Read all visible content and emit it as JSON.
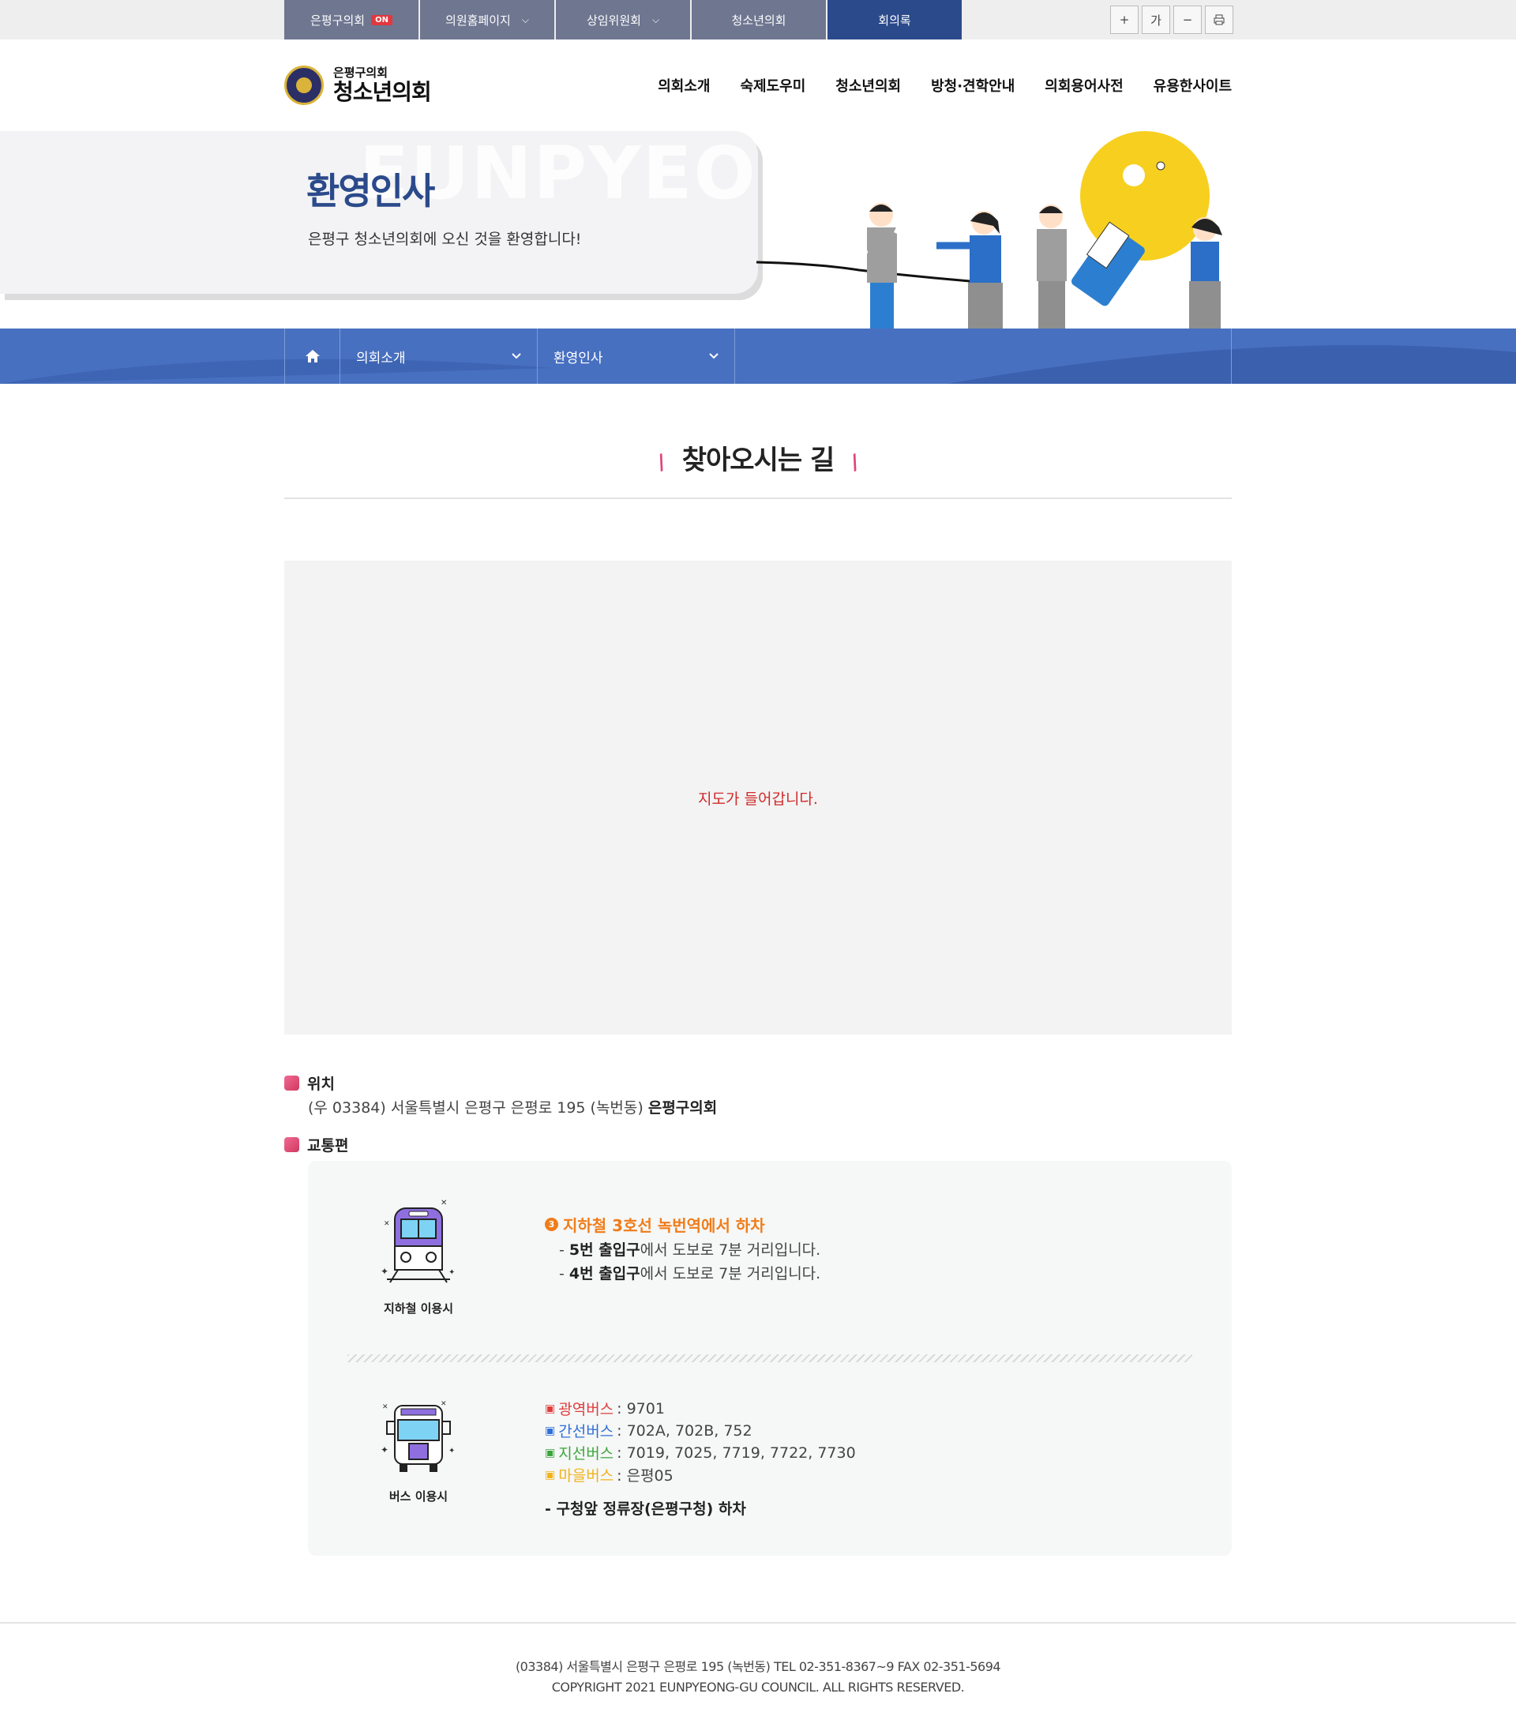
{
  "topbar": {
    "tabs": [
      {
        "label": "은평구의회",
        "badge": "ON"
      },
      {
        "label": "의원홈페이지"
      },
      {
        "label": "상임위원회"
      },
      {
        "label": "청소년의회"
      },
      {
        "label": "회의록"
      }
    ],
    "buttons": {
      "zoom_in": "+",
      "font": "가",
      "zoom_out": "−",
      "print": "⎙"
    }
  },
  "header": {
    "logo_sub": "은평구의회",
    "logo_main": "청소년의회",
    "nav": [
      "의회소개",
      "숙제도우미",
      "청소년의회",
      "방청·견학안내",
      "의회용어사전",
      "유용한사이트"
    ]
  },
  "visual": {
    "watermark": "EUNPYEONG",
    "title": "환영인사",
    "subtitle": "은평구 청소년의회에 오신 것을 환영합니다!"
  },
  "location": {
    "depth1": "의회소개",
    "depth2": "환영인사"
  },
  "section": {
    "title": "찾아오시는 길",
    "map_placeholder": "지도가 들어갑니다."
  },
  "info": {
    "location_heading": "위치",
    "address_prefix": "(우 03384) 서울특별시 은평구 은평로 195 (녹번동)",
    "address_name": "은평구의회",
    "transport_heading": "교통편",
    "subway": {
      "caption": "지하철 이용시",
      "number": "3",
      "heading": "지하철 3호선 녹번역에서 하차",
      "lines": [
        {
          "bold": "5번 출입구",
          "rest": "에서 도보로 7분 거리입니다."
        },
        {
          "bold": "4번 출입구",
          "rest": "에서 도보로 7분 거리입니다."
        }
      ]
    },
    "bus": {
      "caption": "버스 이용시",
      "lines": [
        {
          "type": "광역버스",
          "numbers": ": 9701",
          "color": "#e03c3c"
        },
        {
          "type": "간선버스",
          "numbers": ": 702A, 702B, 752",
          "color": "#2f6fd6"
        },
        {
          "type": "지선버스",
          "numbers": ": 7019, 7025, 7719, 7722, 7730",
          "color": "#3aa63a"
        },
        {
          "type": "마을버스",
          "numbers": ": 은평05",
          "color": "#f2b31a"
        }
      ],
      "stop": "- 구청앞 정류장(은평구청) 하차"
    }
  },
  "footer": {
    "line1": "(03384) 서울특별시 은평구 은평로 195 (녹번동) TEL 02-351-8367~9 FAX 02-351-5694",
    "line2": "COPYRIGHT 2021 EUNPYEONG-GU COUNCIL. ALL RIGHTS RESERVED."
  }
}
